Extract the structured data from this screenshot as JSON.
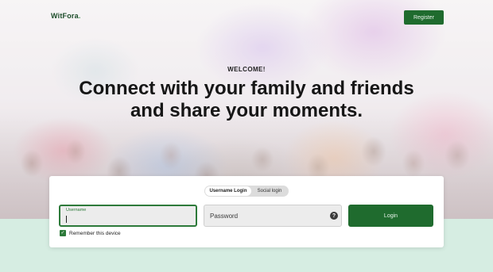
{
  "header": {
    "logo_text": "WitFora",
    "logo_dot": ".",
    "register_label": "Register"
  },
  "hero": {
    "welcome": "WELCOME!",
    "headline_line1": "Connect with your family and friends",
    "headline_line2": "and share your moments."
  },
  "login_card": {
    "tabs": [
      {
        "label": "Username Login",
        "active": true
      },
      {
        "label": "Social login",
        "active": false
      }
    ],
    "username": {
      "label": "Username",
      "value": ""
    },
    "password": {
      "placeholder": "Password",
      "value": ""
    },
    "help_icon": "question-circle-icon",
    "help_glyph": "?",
    "login_label": "Login",
    "remember_label": "Remember this device",
    "remember_checked": true,
    "check_glyph": "✓"
  },
  "colors": {
    "brand_green": "#1f6b2e",
    "accent_green": "#2d7a3a",
    "page_bg": "#d6ede2"
  }
}
